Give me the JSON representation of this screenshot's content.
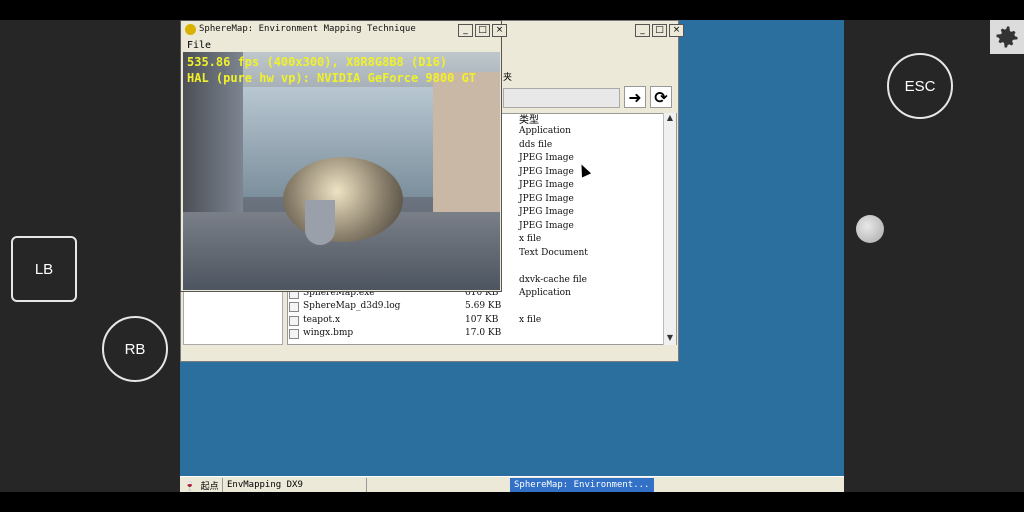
{
  "overlay": {
    "lb": "LB",
    "rb": "RB",
    "esc": "ESC",
    "settings_icon": "gear-icon"
  },
  "explorer": {
    "folder_fragment": "夹",
    "type_header": "类型",
    "types": [
      "Application",
      "dds file",
      "JPEG Image",
      "JPEG Image",
      "JPEG Image",
      "JPEG Image",
      "JPEG Image",
      "JPEG Image",
      "x file",
      "Text Document",
      "",
      "dxvk-cache file",
      "Application",
      "",
      "x file"
    ],
    "files": [
      {
        "name": "SphereMap.exe",
        "size": "610 KB"
      },
      {
        "name": "SphereMap_d3d9.log",
        "size": "5.69 KB"
      },
      {
        "name": "teapot.x",
        "size": "107 KB"
      },
      {
        "name": "wingx.bmp",
        "size": "17.0 KB"
      }
    ],
    "go_icon": "arrow-right-icon",
    "refresh_icon": "refresh-icon"
  },
  "sphere": {
    "title": "SphereMap: Environment Mapping Technique",
    "menu_file": "File",
    "hud_line1": "535.86 fps (400x300), X8R8G8B8 (D16)",
    "hud_line2": "HAL (pure hw vp): NVIDIA GeForce 9800 GT"
  },
  "taskbar": {
    "start": "起点",
    "item1": "EnvMapping DX9",
    "item2": "SphereMap: Environment..."
  },
  "window_buttons": {
    "minimize": "_",
    "maximize": "□",
    "close": "×"
  }
}
